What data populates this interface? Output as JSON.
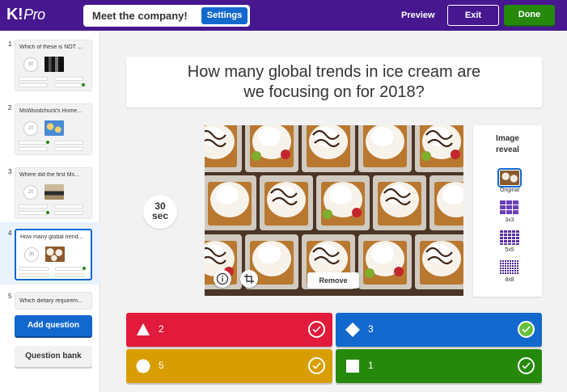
{
  "header": {
    "logo": "K!",
    "logo_suffix": "Pro",
    "quiz_title": "Meet the company!",
    "settings_label": "Settings",
    "preview_label": "Preview",
    "exit_label": "Exit",
    "done_label": "Done"
  },
  "sidebar": {
    "slides": [
      {
        "num": "1",
        "title": "Which of these is NOT ...",
        "timer": "30"
      },
      {
        "num": "2",
        "title": "MsWoodchuck's Home...",
        "timer": "20"
      },
      {
        "num": "3",
        "title": "Where did the first Ms...",
        "timer": "20"
      },
      {
        "num": "4",
        "title": "How many global trend...",
        "timer": "30"
      },
      {
        "num": "5",
        "title": "Which dietary requirem..."
      }
    ],
    "add_question_label": "Add question",
    "question_bank_label": "Question bank"
  },
  "question": {
    "line1": "How many global trends in ice cream are",
    "line2": "we focusing on for 2018?"
  },
  "timer": {
    "value": "30",
    "unit": "sec"
  },
  "image": {
    "remove_label": "Remove",
    "info_icon": "info-icon",
    "crop_icon": "crop-icon"
  },
  "reveal": {
    "title_line1": "Image",
    "title_line2": "reveal",
    "options": [
      {
        "label": "Original",
        "selected": true
      },
      {
        "label": "3x3",
        "selected": false
      },
      {
        "label": "5x5",
        "selected": false
      },
      {
        "label": "8x8",
        "selected": false
      }
    ]
  },
  "answers": [
    {
      "text": "2",
      "shape": "triangle",
      "color": "#e21b3c",
      "correct": false
    },
    {
      "text": "3",
      "shape": "diamond",
      "color": "#1368ce",
      "correct": true
    },
    {
      "text": "5",
      "shape": "circle",
      "color": "#d89e00",
      "correct": false
    },
    {
      "text": "1",
      "shape": "square",
      "color": "#26890c",
      "correct": false
    }
  ],
  "colors": {
    "brand_purple": "#46178f",
    "blue": "#1368ce",
    "green": "#26890c",
    "check_green": "#66bf39"
  }
}
